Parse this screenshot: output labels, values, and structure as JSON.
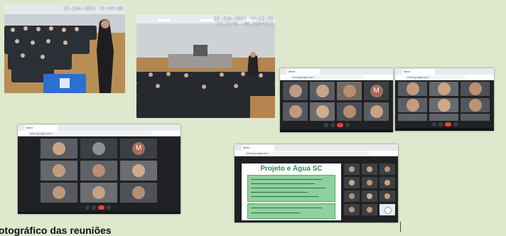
{
  "photos": {
    "auditorium_1": {
      "stamp_line1": "15-jun-2021 14:44:08"
    },
    "auditorium_2": {
      "stamp_line1": "15-jun-2021 15:12:35",
      "stamp_line2": "-27,3178 -48,6994313"
    }
  },
  "meet_window_3": {
    "tab_label": "Meet",
    "url": "meet.google.com",
    "avatar_letter": "M"
  },
  "meet_window_4": {
    "tab_label": "Meet",
    "url": "meet.google.com"
  },
  "meet_window_5": {
    "tab_label": "Meet",
    "url": "meet.google.com",
    "avatar_letter": "M"
  },
  "meet_window_6": {
    "tab_label": "Meet",
    "url": "meet.google.com",
    "slide_title_line1": "Projeto e",
    "slide_title_line2": "Água SC"
  },
  "caption": "otográfico das reuniões"
}
